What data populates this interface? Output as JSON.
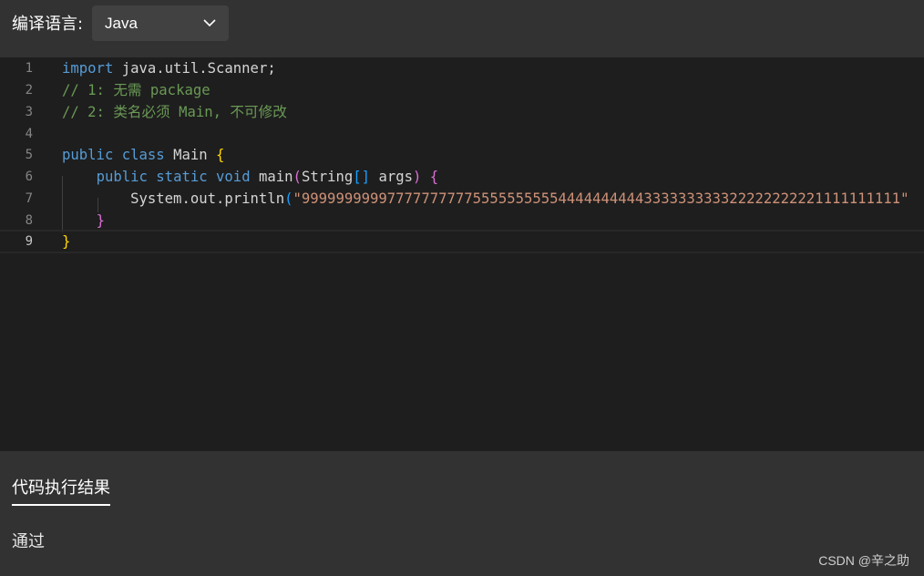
{
  "header": {
    "language_label": "编译语言:",
    "language_value": "Java"
  },
  "editor": {
    "line_numbers": [
      "1",
      "2",
      "3",
      "4",
      "5",
      "6",
      "7",
      "8",
      "9"
    ],
    "line1": {
      "kw": "import",
      "rest": " java.util.Scanner;"
    },
    "line2": {
      "comment": "// 1: 无需 package"
    },
    "line3": {
      "comment": "// 2: 类名必须 Main, 不可修改"
    },
    "line5": {
      "kw1": "public",
      "sp": " ",
      "kw2": "class",
      "rest": " Main ",
      "brace": "{"
    },
    "line6": {
      "indent": "    ",
      "kw1": "public",
      "kw2": "static",
      "kw3": "void",
      "name": " main",
      "paren_open": "(",
      "type": "String",
      "brackets": "[]",
      "arg": " args",
      "paren_close": ")",
      "brace": "{"
    },
    "line7": {
      "indent": "        ",
      "call": "System.out.println",
      "paren_open": "(",
      "string": "\"9999999999777777777755555555554444444444333333333322222222221111111111\""
    },
    "line8": {
      "indent": "    ",
      "brace": "}"
    },
    "line9": {
      "brace": "}"
    }
  },
  "results": {
    "tab_label": "代码执行结果",
    "status": "通过"
  },
  "watermark": "CSDN @辛之助"
}
